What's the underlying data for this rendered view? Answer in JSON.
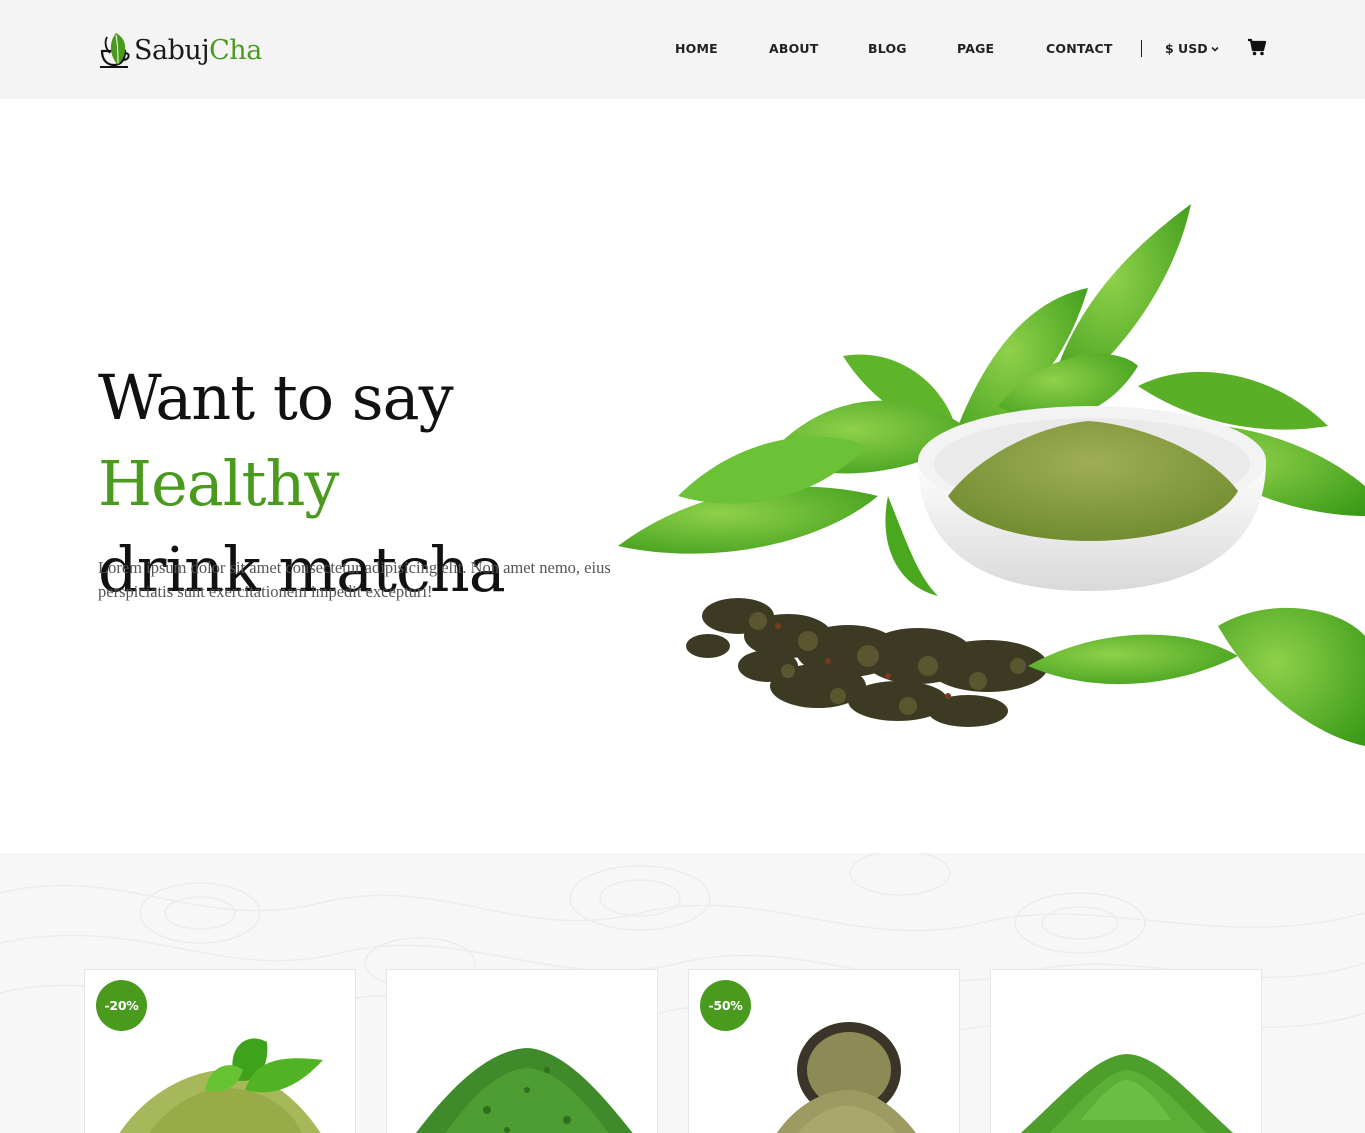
{
  "brand": {
    "name_part1": "Sabuj",
    "name_part2": "Cha",
    "accent_color": "#4a9a1e"
  },
  "nav": {
    "items": [
      "HOME",
      "ABOUT",
      "BLOG",
      "PAGE",
      "CONTACT"
    ],
    "currency": "$ USD",
    "currency_icon": "chevron-down-icon",
    "cart_icon": "cart-icon"
  },
  "hero": {
    "title_part1": "Want to say ",
    "title_highlight": "Healthy",
    "title_part2": "drink matcha",
    "description": "Lorem ipsum dolor sit amet consectetur adipisicing elit. Non amet nemo, eius perspiciatis sunt exercitationem impedit excepturi!",
    "image_icon": "matcha-bowl-with-tea-leaves-image"
  },
  "products": [
    {
      "badge": "-20%",
      "image_icon": "matcha-powder-with-leaves-image"
    },
    {
      "badge": "",
      "image_icon": "green-tea-leaf-pile-image"
    },
    {
      "badge": "-50%",
      "image_icon": "matcha-powder-in-bowl-image"
    },
    {
      "badge": "",
      "image_icon": "matcha-powder-pile-image"
    }
  ]
}
